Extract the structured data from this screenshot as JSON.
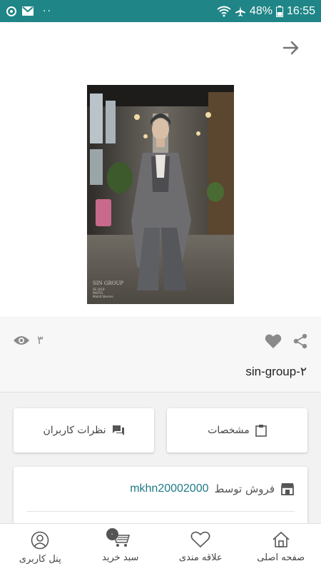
{
  "status_bar": {
    "battery": "48%",
    "time": "16:55",
    "dots": "··"
  },
  "colors": {
    "accent": "#1f8586",
    "seller_link": "#1f7b86",
    "icon_gray": "#8a8a8a"
  },
  "product": {
    "image_label": "SIN GROUP",
    "image_caption_lines": [
      "SS 2019",
      "PHOTO",
      "Mahdi Sherani"
    ],
    "views": "۳",
    "title": "sin-group-۲"
  },
  "tabs": {
    "specs": "مشخصات",
    "reviews": "نظرات کاربران"
  },
  "seller": {
    "label": "فروش توسط",
    "name": "mkhn20002000"
  },
  "bottom_nav": {
    "items": [
      {
        "label": "صفحه اصلی",
        "icon": "home-icon"
      },
      {
        "label": "علاقه مندی",
        "icon": "heart-outline-icon"
      },
      {
        "label": "سبد خرید",
        "icon": "cart-icon",
        "badge": "۰"
      },
      {
        "label": "پنل کاربری",
        "icon": "user-icon"
      }
    ]
  }
}
